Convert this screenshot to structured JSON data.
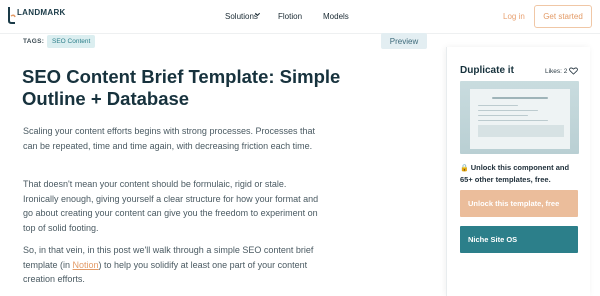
{
  "nav": {
    "logo_text": "LANDMARK",
    "items": [
      {
        "label": "Solutions"
      },
      {
        "label": "Flotion"
      },
      {
        "label": "Models"
      }
    ],
    "login_label": "Log in",
    "cta_label": "Get started"
  },
  "tags": {
    "label": "TAGS:",
    "items": [
      "SEO Content"
    ]
  },
  "preview_label": "Preview",
  "article": {
    "title": "SEO Content Brief Template: Simple Outline + Database",
    "paragraphs": [
      "Scaling your content efforts begins with strong processes. Processes that can be repeated, time and time again, with decreasing friction each time.",
      "That doesn't mean your content should be formulaic, rigid or stale. Ironically enough, giving yourself a clear structure for how your format and go about creating your content can give you the freedom to experiment on top of solid footing."
    ],
    "p3_before": "So, in that vein, in this post we'll walk through a simple SEO content brief template (in ",
    "p3_link": "Notion",
    "p3_after": ") to help you solidify at least one part of your content creation efforts."
  },
  "sidebar": {
    "title": "Duplicate it",
    "likes_label": "Likes: 2",
    "unlock_lock_glyph": "🔒",
    "unlock_text": "Unlock this component and 65+ other templates, free.",
    "unlock_button_label": "Unlock this template, free",
    "niche_button_label": "Niche Site OS"
  },
  "colors": {
    "accent_orange": "#e39b67",
    "unlock_button": "#ebbd9b",
    "teal": "#2c7f8a",
    "tag_bg": "#dbeef0",
    "heading": "#17323d"
  },
  "icons": [
    "landmark-logo-icon",
    "chevron-down-icon",
    "heart-icon",
    "lock-icon"
  ]
}
